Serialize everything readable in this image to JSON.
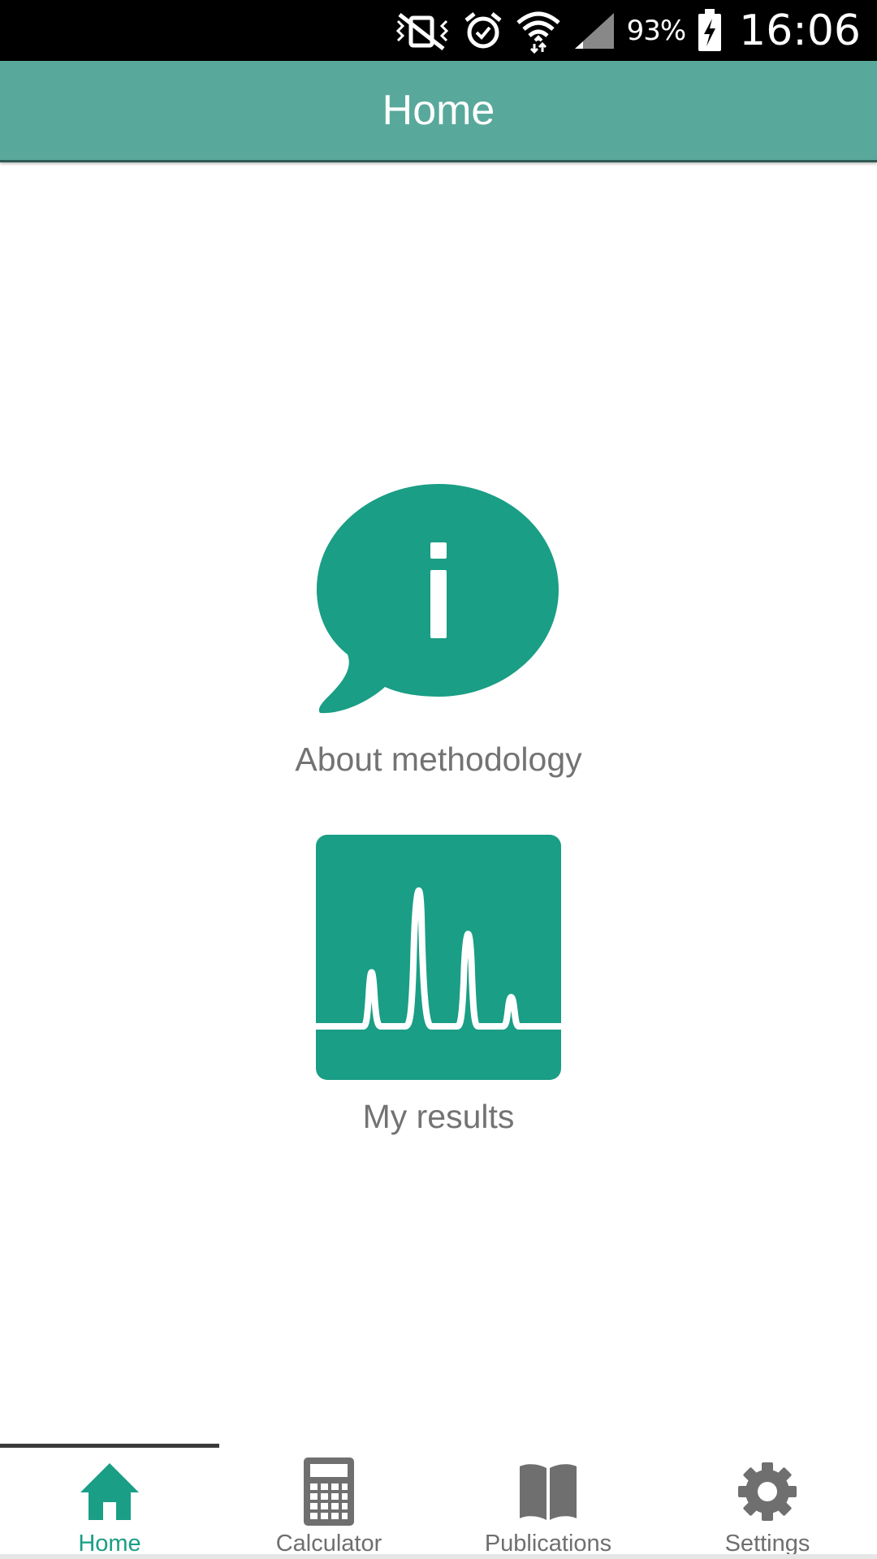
{
  "status_bar": {
    "battery_percent": "93%",
    "time": "16:06",
    "icons": [
      "mute-vibrate-icon",
      "alarm-icon",
      "wifi-icon",
      "signal-icon",
      "battery-charging-icon"
    ]
  },
  "app_bar": {
    "title": "Home"
  },
  "main": {
    "tiles": [
      {
        "label": "About methodology",
        "icon": "info-speech-bubble-icon"
      },
      {
        "label": "My results",
        "icon": "chromatogram-icon"
      }
    ]
  },
  "bottom_nav": {
    "items": [
      {
        "label": "Home",
        "icon": "home-icon",
        "active": true
      },
      {
        "label": "Calculator",
        "icon": "calculator-icon",
        "active": false
      },
      {
        "label": "Publications",
        "icon": "book-icon",
        "active": false
      },
      {
        "label": "Settings",
        "icon": "gear-icon",
        "active": false
      }
    ]
  },
  "colors": {
    "primary": "#58a99b",
    "accent": "#1a9e85",
    "text_muted": "#737373"
  }
}
